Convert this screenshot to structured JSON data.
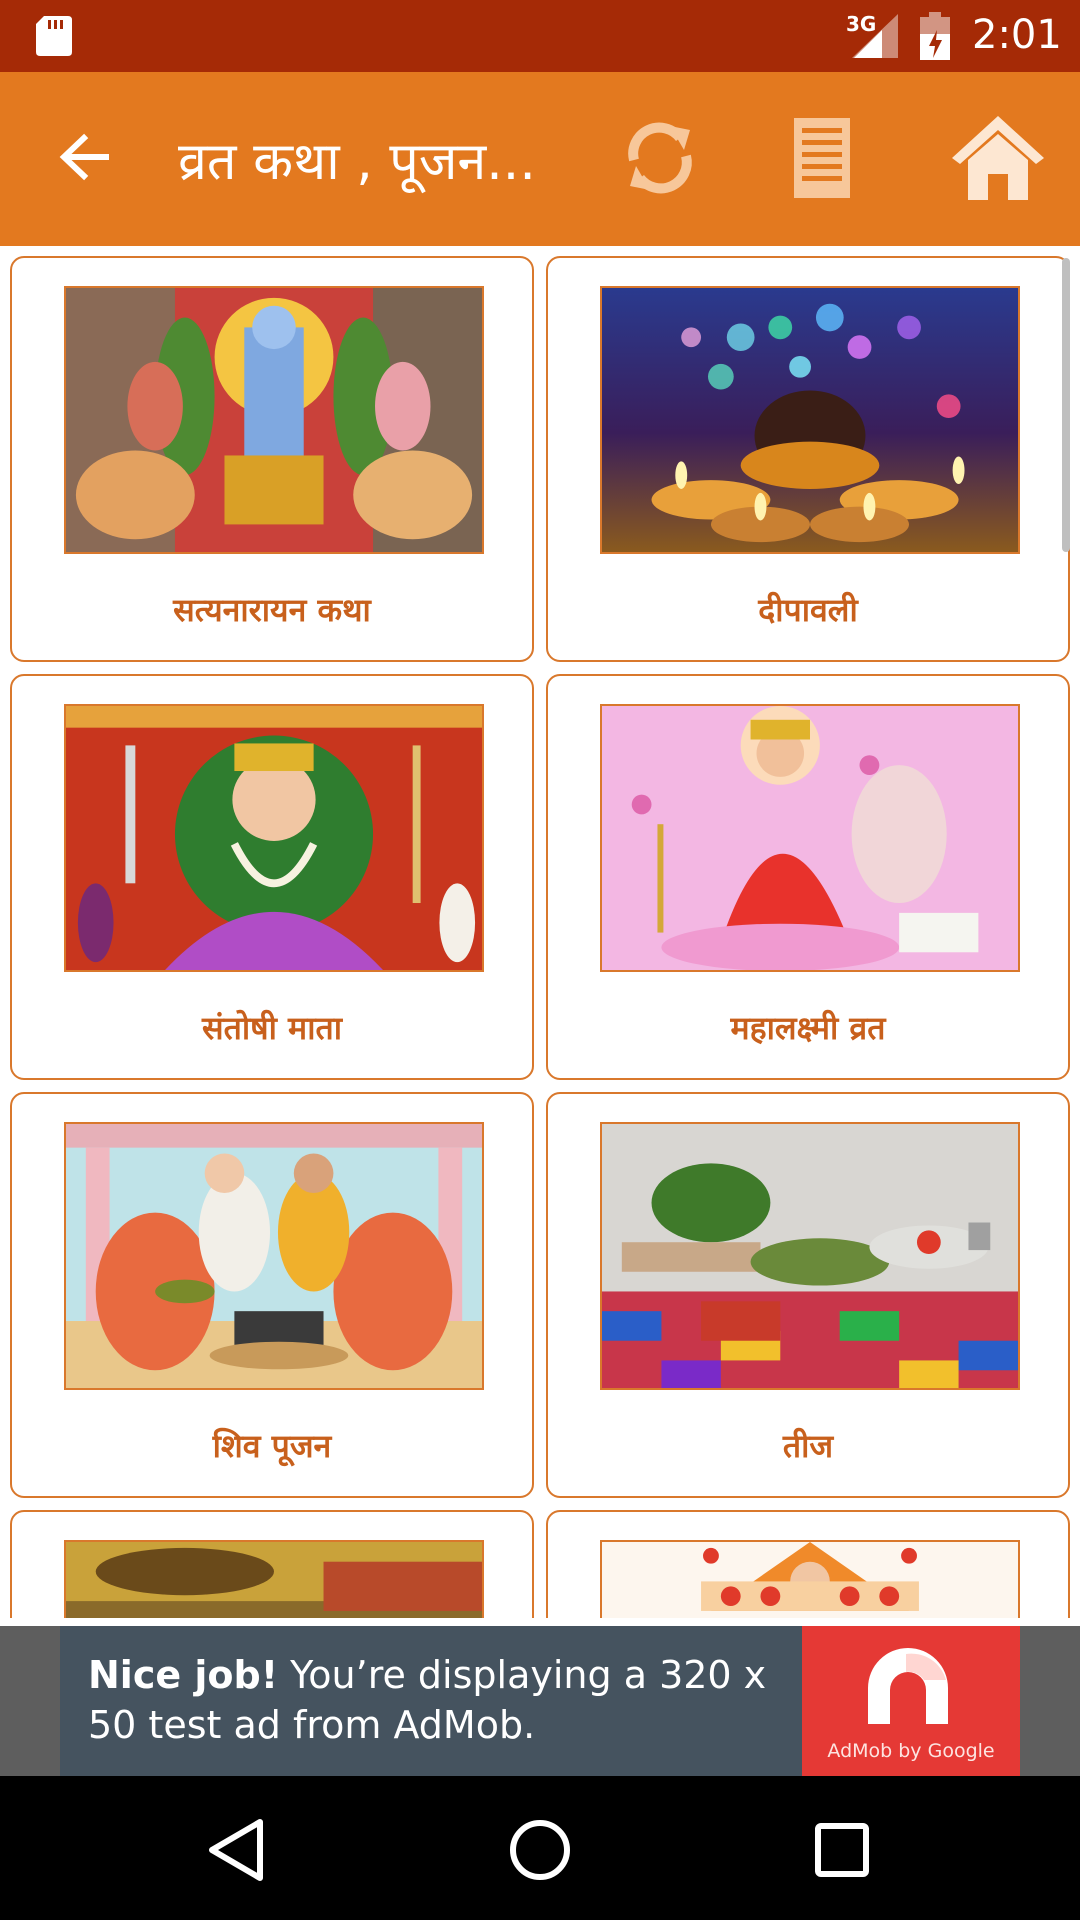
{
  "status_bar": {
    "network": "3G",
    "time": "2:01",
    "icons": [
      "sd-card-icon",
      "signal-icon",
      "battery-icon"
    ]
  },
  "app_bar": {
    "title": "व्रत कथा , पूजन...",
    "icons": [
      "back-arrow-icon",
      "refresh-icon",
      "list-icon",
      "home-icon"
    ]
  },
  "cards": [
    {
      "label": "सत्यनारायन कथा"
    },
    {
      "label": "दीपावली"
    },
    {
      "label": "संतोषी माता"
    },
    {
      "label": "महालक्ष्मी व्रत"
    },
    {
      "label": "शिव पूजन"
    },
    {
      "label": "तीज"
    },
    {
      "label": ""
    },
    {
      "label": ""
    }
  ],
  "ad": {
    "headline": "Nice job!",
    "body": " You’re displaying a 320 x 50 test ad from AdMob.",
    "brand": "AdMob by Google"
  },
  "nav_bar": {
    "icons": [
      "nav-back-icon",
      "nav-home-icon",
      "nav-recents-icon"
    ]
  },
  "colors": {
    "status_bar": "#a52a06",
    "app_bar": "#e3791f",
    "card_border": "#d9782c",
    "card_label": "#c8601c",
    "ad_background": "#45535f",
    "ad_logo": "#e53935"
  }
}
